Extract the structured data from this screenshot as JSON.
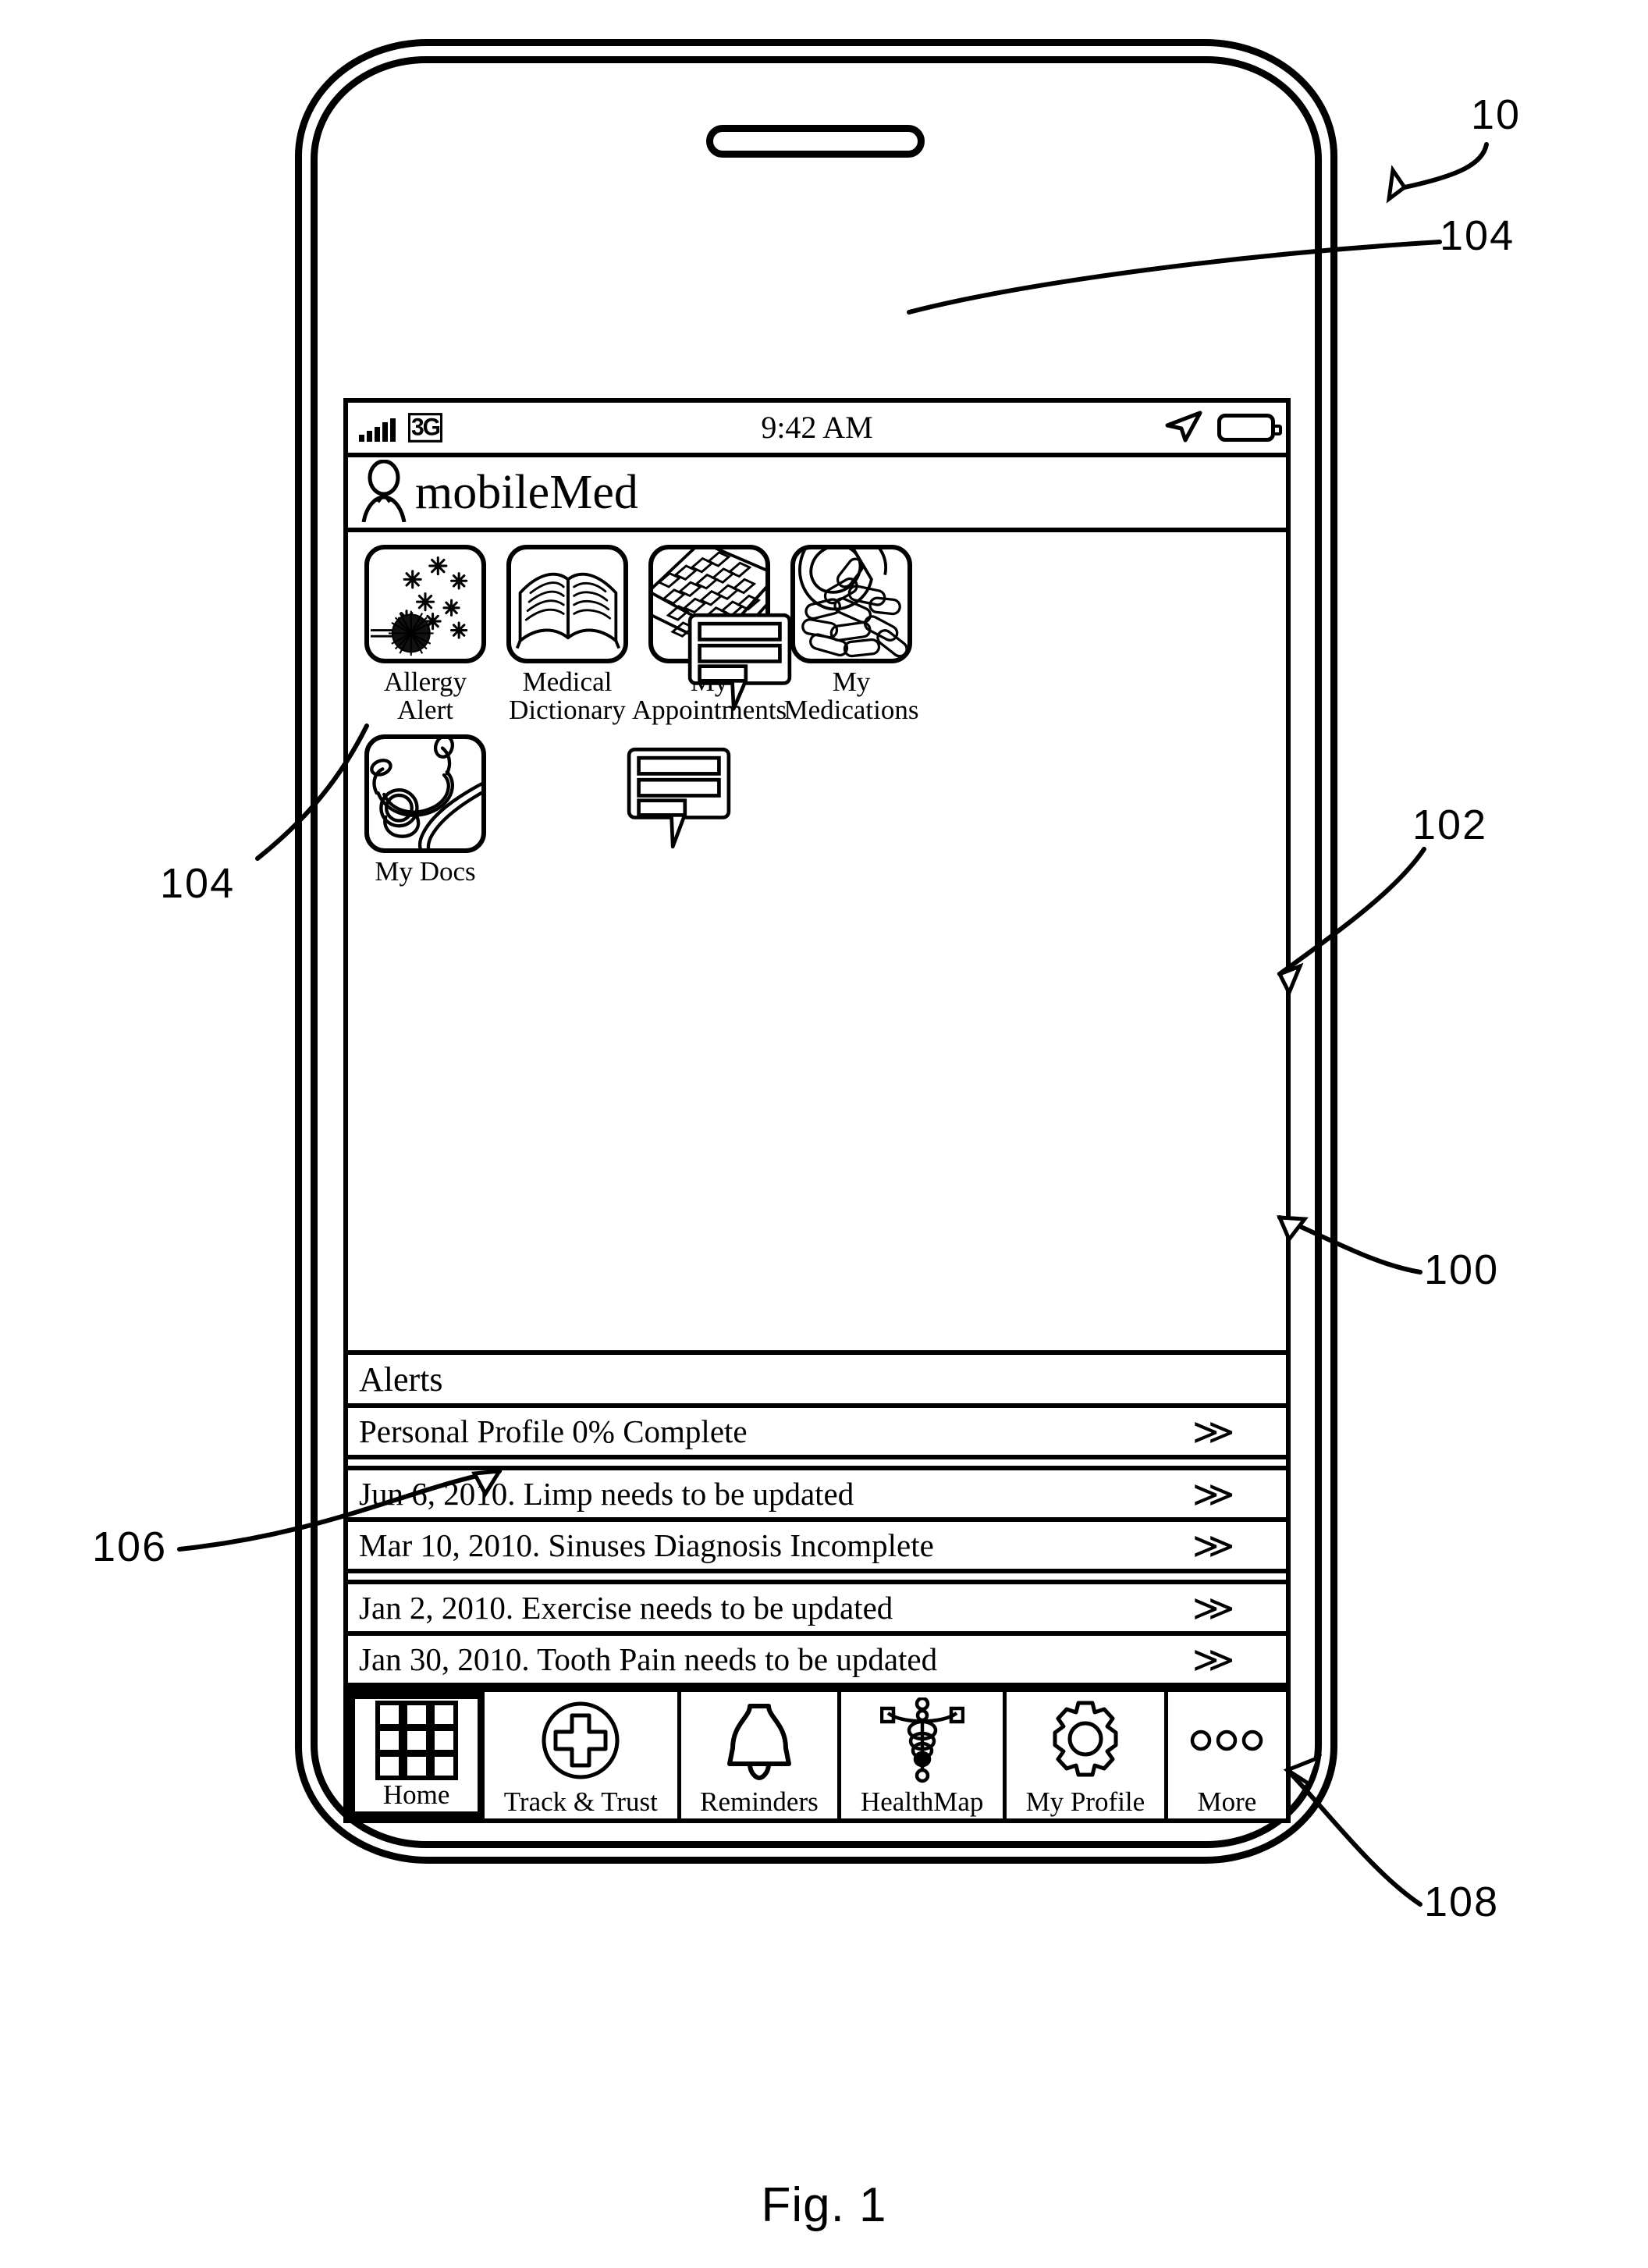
{
  "figure": {
    "caption": "Fig. 1",
    "reference_numerals": [
      {
        "id": "10",
        "label": "10"
      },
      {
        "id": "104a",
        "label": "104"
      },
      {
        "id": "102",
        "label": "102"
      },
      {
        "id": "100",
        "label": "100"
      },
      {
        "id": "104b",
        "label": "104"
      },
      {
        "id": "106",
        "label": "106"
      },
      {
        "id": "108",
        "label": "108"
      }
    ]
  },
  "status_bar": {
    "carrier_signal": "signal-bars-icon",
    "network": "3G",
    "time": "9:42 AM",
    "location_icon": "location-arrow-icon",
    "battery_icon": "battery-icon"
  },
  "app_bar": {
    "avatar_icon": "person-icon",
    "title": "mobileMed"
  },
  "apps": {
    "row1": [
      {
        "label": "Allergy Alert",
        "icon": "pollen-allergen-icon"
      },
      {
        "label": "Medical\nDictionary",
        "icon": "open-book-icon"
      },
      {
        "label": "My\nAppointments",
        "icon": "calendar-icon"
      },
      {
        "label": "My\nMedications",
        "icon": "pill-bottle-icon"
      }
    ],
    "row2": [
      {
        "label": "My Docs",
        "icon": "stethoscope-icon"
      }
    ],
    "bubbles": [
      {
        "icon": "speech-bubble-icon"
      },
      {
        "icon": "speech-bubble-icon"
      }
    ]
  },
  "alerts": {
    "header": "Alerts",
    "chevron": "≫",
    "items": [
      {
        "text": "Personal Profile 0% Complete"
      },
      {
        "text": "Jun 6, 2010. Limp needs to be updated"
      },
      {
        "text": "Mar 10, 2010. Sinuses Diagnosis Incomplete"
      },
      {
        "text": "Jan 2, 2010. Exercise needs to be updated"
      },
      {
        "text": "Jan 30, 2010. Tooth Pain needs to be updated"
      }
    ]
  },
  "tab_bar": {
    "selected": "Home",
    "tabs": [
      {
        "label": "Home",
        "icon": "grid-icon"
      },
      {
        "label": "Track & Trust",
        "icon": "medical-cross-circle-icon"
      },
      {
        "label": "Reminders",
        "icon": "bell-icon"
      },
      {
        "label": "HealthMap",
        "icon": "caduceus-icon"
      },
      {
        "label": "My Profile",
        "icon": "gear-icon"
      },
      {
        "label": "More",
        "icon": "ellipsis-icon"
      }
    ]
  }
}
